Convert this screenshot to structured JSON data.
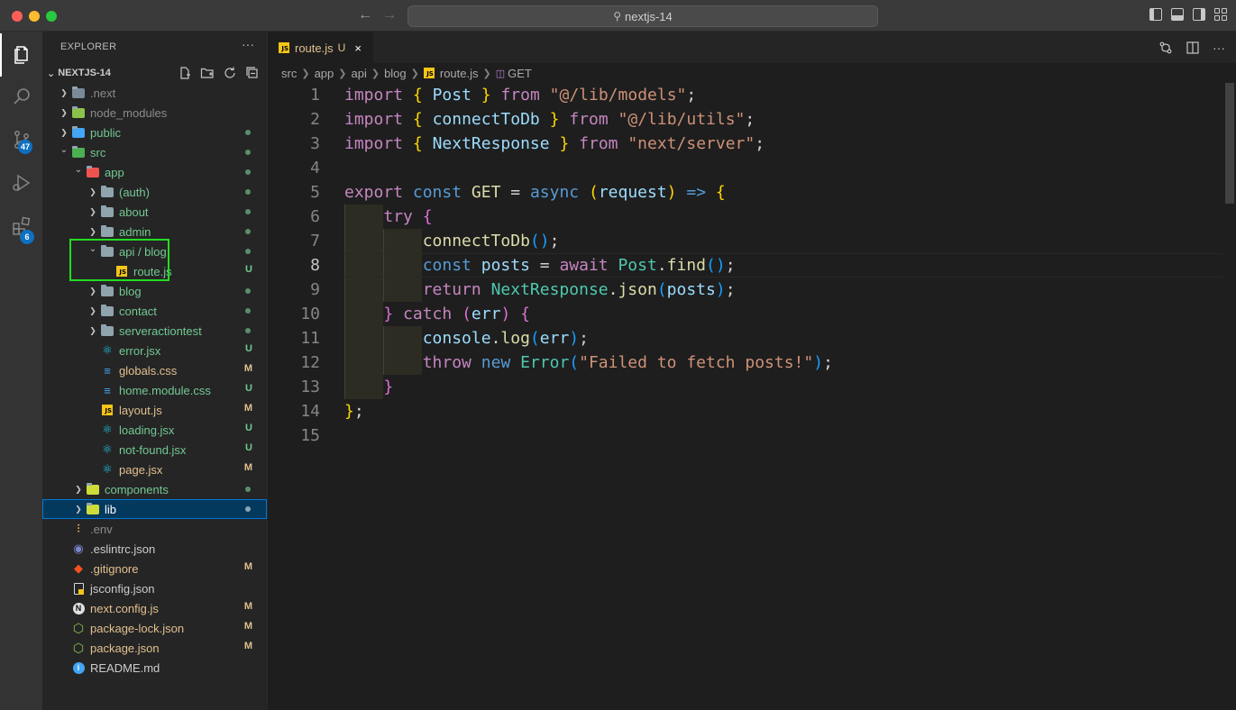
{
  "window": {
    "search_text": "nextjs-14"
  },
  "activity": {
    "scm_badge": "47",
    "extensions_badge": "6"
  },
  "explorer": {
    "title": "EXPLORER",
    "more": "···",
    "root": "NEXTJS-14",
    "items": [
      {
        "name": ".next",
        "depth": 0,
        "kind": "folder",
        "chev": "closed",
        "status": "",
        "color": "#8b8b8b",
        "icon_color": "#7a8a99"
      },
      {
        "name": "node_modules",
        "depth": 0,
        "kind": "folder",
        "chev": "closed",
        "status": "",
        "color": "#8b8b8b",
        "icon_color": "#8bc34a"
      },
      {
        "name": "public",
        "depth": 0,
        "kind": "folder",
        "chev": "closed",
        "status": "dot",
        "color": "#73c991",
        "icon_color": "#42a5f5"
      },
      {
        "name": "src",
        "depth": 0,
        "kind": "folder",
        "chev": "open",
        "status": "dot",
        "color": "#73c991",
        "icon_color": "#4caf50"
      },
      {
        "name": "app",
        "depth": 1,
        "kind": "folder",
        "chev": "open",
        "status": "dot",
        "color": "#73c991",
        "icon_color": "#ef5350"
      },
      {
        "name": "(auth)",
        "depth": 2,
        "kind": "folder",
        "chev": "closed",
        "status": "dot",
        "color": "#73c991",
        "icon_color": "#90a4ae"
      },
      {
        "name": "about",
        "depth": 2,
        "kind": "folder",
        "chev": "closed",
        "status": "dot",
        "color": "#73c991",
        "icon_color": "#90a4ae"
      },
      {
        "name": "admin",
        "depth": 2,
        "kind": "folder",
        "chev": "closed",
        "status": "dot",
        "color": "#73c991",
        "icon_color": "#90a4ae"
      },
      {
        "name": "api / blog",
        "depth": 2,
        "kind": "folder",
        "chev": "open",
        "status": "dot",
        "color": "#73c991",
        "icon_color": "#90a4ae"
      },
      {
        "name": "route.js",
        "depth": 3,
        "kind": "js",
        "chev": "none",
        "status": "U",
        "color": "#73c991"
      },
      {
        "name": "blog",
        "depth": 2,
        "kind": "folder",
        "chev": "closed",
        "status": "dot",
        "color": "#73c991",
        "icon_color": "#90a4ae"
      },
      {
        "name": "contact",
        "depth": 2,
        "kind": "folder",
        "chev": "closed",
        "status": "dot",
        "color": "#73c991",
        "icon_color": "#90a4ae"
      },
      {
        "name": "serveractiontest",
        "depth": 2,
        "kind": "folder",
        "chev": "closed",
        "status": "dot",
        "color": "#73c991",
        "icon_color": "#90a4ae"
      },
      {
        "name": "error.jsx",
        "depth": 2,
        "kind": "react",
        "chev": "none",
        "status": "U",
        "color": "#73c991"
      },
      {
        "name": "globals.css",
        "depth": 2,
        "kind": "css",
        "chev": "none",
        "status": "M",
        "color": "#e2c08d"
      },
      {
        "name": "home.module.css",
        "depth": 2,
        "kind": "css",
        "chev": "none",
        "status": "U",
        "color": "#73c991"
      },
      {
        "name": "layout.js",
        "depth": 2,
        "kind": "js",
        "chev": "none",
        "status": "M",
        "color": "#e2c08d"
      },
      {
        "name": "loading.jsx",
        "depth": 2,
        "kind": "react",
        "chev": "none",
        "status": "U",
        "color": "#73c991"
      },
      {
        "name": "not-found.jsx",
        "depth": 2,
        "kind": "react",
        "chev": "none",
        "status": "U",
        "color": "#73c991"
      },
      {
        "name": "page.jsx",
        "depth": 2,
        "kind": "react",
        "chev": "none",
        "status": "M",
        "color": "#e2c08d"
      },
      {
        "name": "components",
        "depth": 1,
        "kind": "folder",
        "chev": "closed",
        "status": "dot",
        "color": "#73c991",
        "icon_color": "#cddc39"
      },
      {
        "name": "lib",
        "depth": 1,
        "kind": "folder",
        "chev": "closed",
        "status": "dot",
        "color": "#ffffff",
        "icon_color": "#cddc39",
        "selected": true
      },
      {
        "name": ".env",
        "depth": 0,
        "kind": "env",
        "chev": "none",
        "status": "",
        "color": "#8b8b8b"
      },
      {
        "name": ".eslintrc.json",
        "depth": 0,
        "kind": "eslint",
        "chev": "none",
        "status": "",
        "color": "#cccccc"
      },
      {
        "name": ".gitignore",
        "depth": 0,
        "kind": "git",
        "chev": "none",
        "status": "M",
        "color": "#e2c08d"
      },
      {
        "name": "jsconfig.json",
        "depth": 0,
        "kind": "jsconfig",
        "chev": "none",
        "status": "",
        "color": "#cccccc"
      },
      {
        "name": "next.config.js",
        "depth": 0,
        "kind": "next",
        "chev": "none",
        "status": "M",
        "color": "#e2c08d"
      },
      {
        "name": "package-lock.json",
        "depth": 0,
        "kind": "npm",
        "chev": "none",
        "status": "M",
        "color": "#e2c08d"
      },
      {
        "name": "package.json",
        "depth": 0,
        "kind": "npm",
        "chev": "none",
        "status": "M",
        "color": "#e2c08d"
      },
      {
        "name": "README.md",
        "depth": 0,
        "kind": "info",
        "chev": "none",
        "status": "",
        "color": "#cccccc"
      }
    ]
  },
  "tab": {
    "name": "route.js",
    "state": "U",
    "close": "×"
  },
  "breadcrumb": {
    "parts": [
      "src",
      "app",
      "api",
      "blog"
    ],
    "file": "route.js",
    "symbol": "GET"
  },
  "editor": {
    "current_line": 8,
    "lines": [
      {
        "n": "1",
        "code": [
          [
            "import",
            "kw"
          ],
          [
            " ",
            "pl"
          ],
          [
            "{",
            "br1"
          ],
          [
            " ",
            "pl"
          ],
          [
            "Post",
            "id"
          ],
          [
            " ",
            "pl"
          ],
          [
            "}",
            "br1"
          ],
          [
            " ",
            "pl"
          ],
          [
            "from",
            "kw"
          ],
          [
            " ",
            "pl"
          ],
          [
            "\"@/lib/models\"",
            "str"
          ],
          [
            ";",
            "pl"
          ]
        ]
      },
      {
        "n": "2",
        "code": [
          [
            "import",
            "kw"
          ],
          [
            " ",
            "pl"
          ],
          [
            "{",
            "br1"
          ],
          [
            " ",
            "pl"
          ],
          [
            "connectToDb",
            "id"
          ],
          [
            " ",
            "pl"
          ],
          [
            "}",
            "br1"
          ],
          [
            " ",
            "pl"
          ],
          [
            "from",
            "kw"
          ],
          [
            " ",
            "pl"
          ],
          [
            "\"@/lib/utils\"",
            "str"
          ],
          [
            ";",
            "pl"
          ]
        ]
      },
      {
        "n": "3",
        "code": [
          [
            "import",
            "kw"
          ],
          [
            " ",
            "pl"
          ],
          [
            "{",
            "br1"
          ],
          [
            " ",
            "pl"
          ],
          [
            "NextResponse",
            "id"
          ],
          [
            " ",
            "pl"
          ],
          [
            "}",
            "br1"
          ],
          [
            " ",
            "pl"
          ],
          [
            "from",
            "kw"
          ],
          [
            " ",
            "pl"
          ],
          [
            "\"next/server\"",
            "str"
          ],
          [
            ";",
            "pl"
          ]
        ]
      },
      {
        "n": "4",
        "code": []
      },
      {
        "n": "5",
        "code": [
          [
            "export",
            "kw"
          ],
          [
            " ",
            "pl"
          ],
          [
            "const",
            "kb"
          ],
          [
            " ",
            "pl"
          ],
          [
            "GET",
            "fn"
          ],
          [
            " = ",
            "op"
          ],
          [
            "async",
            "kb"
          ],
          [
            " ",
            "pl"
          ],
          [
            "(",
            "br1"
          ],
          [
            "request",
            "id"
          ],
          [
            ")",
            "br1"
          ],
          [
            " ",
            "pl"
          ],
          [
            "=>",
            "kb"
          ],
          [
            " ",
            "pl"
          ],
          [
            "{",
            "br1"
          ]
        ]
      },
      {
        "n": "6",
        "code": [
          [
            "    ",
            "pl"
          ],
          [
            "try",
            "kw"
          ],
          [
            " ",
            "pl"
          ],
          [
            "{",
            "br2"
          ]
        ]
      },
      {
        "n": "7",
        "code": [
          [
            "        ",
            "pl"
          ],
          [
            "connectToDb",
            "fn"
          ],
          [
            "()",
            "br3"
          ],
          [
            ";",
            "pl"
          ]
        ]
      },
      {
        "n": "8",
        "code": [
          [
            "        ",
            "pl"
          ],
          [
            "const",
            "kb"
          ],
          [
            " ",
            "pl"
          ],
          [
            "posts",
            "id"
          ],
          [
            " = ",
            "op"
          ],
          [
            "await",
            "kw"
          ],
          [
            " ",
            "pl"
          ],
          [
            "Post",
            "ty"
          ],
          [
            ".",
            "pl"
          ],
          [
            "find",
            "fn"
          ],
          [
            "()",
            "br3"
          ],
          [
            ";",
            "pl"
          ]
        ]
      },
      {
        "n": "9",
        "code": [
          [
            "        ",
            "pl"
          ],
          [
            "return",
            "kw"
          ],
          [
            " ",
            "pl"
          ],
          [
            "NextResponse",
            "ty"
          ],
          [
            ".",
            "pl"
          ],
          [
            "json",
            "fn"
          ],
          [
            "(",
            "br3"
          ],
          [
            "posts",
            "id"
          ],
          [
            ")",
            "br3"
          ],
          [
            ";",
            "pl"
          ]
        ]
      },
      {
        "n": "10",
        "code": [
          [
            "    ",
            "pl"
          ],
          [
            "}",
            "br2"
          ],
          [
            " ",
            "pl"
          ],
          [
            "catch",
            "kw"
          ],
          [
            " ",
            "pl"
          ],
          [
            "(",
            "br2"
          ],
          [
            "err",
            "id"
          ],
          [
            ")",
            "br2"
          ],
          [
            " ",
            "pl"
          ],
          [
            "{",
            "br2"
          ]
        ]
      },
      {
        "n": "11",
        "code": [
          [
            "        ",
            "pl"
          ],
          [
            "console",
            "id"
          ],
          [
            ".",
            "pl"
          ],
          [
            "log",
            "fn"
          ],
          [
            "(",
            "br3"
          ],
          [
            "err",
            "id"
          ],
          [
            ")",
            "br3"
          ],
          [
            ";",
            "pl"
          ]
        ]
      },
      {
        "n": "12",
        "code": [
          [
            "        ",
            "pl"
          ],
          [
            "throw",
            "kw"
          ],
          [
            " ",
            "pl"
          ],
          [
            "new",
            "kb"
          ],
          [
            " ",
            "pl"
          ],
          [
            "Error",
            "ty"
          ],
          [
            "(",
            "br3"
          ],
          [
            "\"Failed to fetch posts!\"",
            "str"
          ],
          [
            ")",
            "br3"
          ],
          [
            ";",
            "pl"
          ]
        ]
      },
      {
        "n": "13",
        "code": [
          [
            "    ",
            "pl"
          ],
          [
            "}",
            "br2"
          ]
        ]
      },
      {
        "n": "14",
        "code": [
          [
            "}",
            "br1"
          ],
          [
            ";",
            "pl"
          ]
        ]
      },
      {
        "n": "15",
        "code": []
      }
    ]
  }
}
